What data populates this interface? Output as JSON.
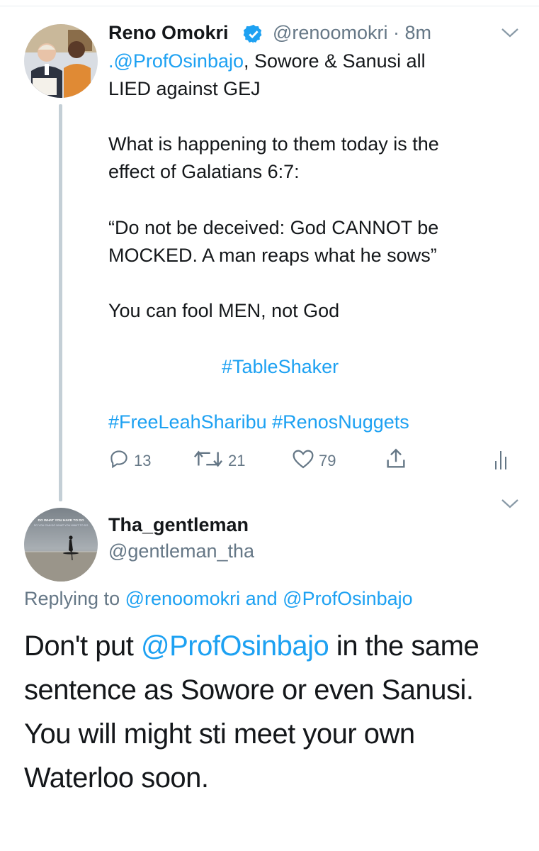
{
  "tweet": {
    "author_name": "Reno Omokri",
    "author_handle": "@renoomokri",
    "time": "· 8m",
    "mention": ".@ProfOsinbajo",
    "line1_rest": ", Sowore & Sanusi all",
    "line2": "LIED against GEJ",
    "line3": "What is happening to them today is the",
    "line4": "effect of Galatians 6:7:",
    "line5": "“Do not be deceived: God CANNOT be",
    "line6": "MOCKED. A man reaps what he sows”",
    "line7": "You can fool MEN, not God",
    "hashtag1": "#TableShaker",
    "hashtag2": "#FreeLeahSharibu #RenosNuggets",
    "replies": "13",
    "retweets": "21",
    "likes": "79"
  },
  "reply": {
    "author_name": "Tha_gentleman",
    "author_handle": "@gentleman_tha",
    "avatar_caption_1": "DO WHAT YOU HAVE TO DO",
    "avatar_caption_2": "SO YOU CAN DO WHAT YOU WANT TO DO",
    "replying_label": "Replying to",
    "replying_user1": "@renoomokri",
    "replying_and": "and",
    "replying_user2": "@ProfOsinbajo",
    "text_l1_a": "Don't put ",
    "text_l1_mention": "@ProfOsinbajo",
    "text_l1_b": " in the same",
    "text_l2": "sentence as Sowore or even Sanusi.",
    "text_l3": "You will might sti meet your own",
    "text_l4": "Waterloo soon."
  },
  "colors": {
    "link": "#1da1f2",
    "secondary_text": "#657786",
    "thread_line": "#c4cfd6"
  }
}
